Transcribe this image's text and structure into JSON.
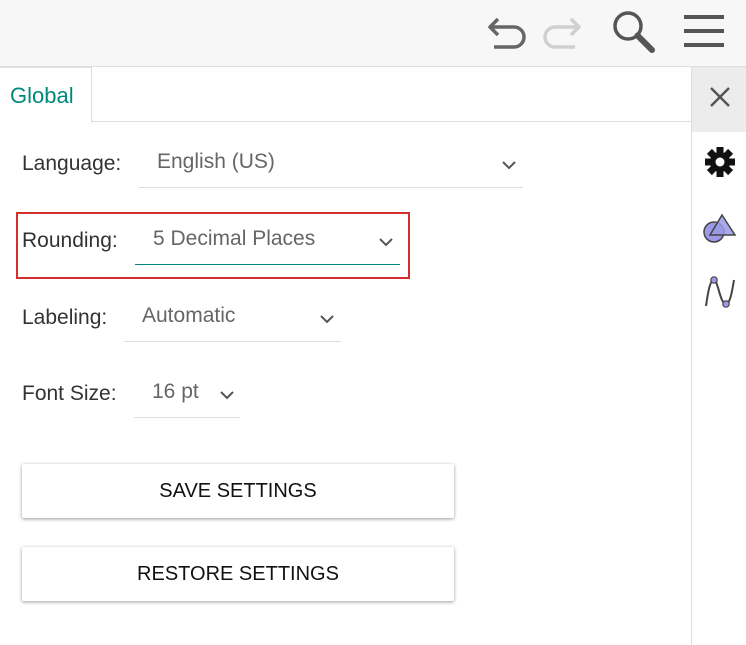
{
  "toolbar": {
    "undo_icon": "undo-icon",
    "redo_icon": "redo-icon",
    "search_icon": "search-icon",
    "menu_icon": "menu-icon"
  },
  "tabs": [
    {
      "label": "Global",
      "active": true
    }
  ],
  "settings": {
    "language": {
      "label": "Language:",
      "value": "English (US)"
    },
    "rounding": {
      "label": "Rounding:",
      "value": "5 Decimal Places"
    },
    "labeling": {
      "label": "Labeling:",
      "value": "Automatic"
    },
    "font_size": {
      "label": "Font Size:",
      "value": "16 pt"
    }
  },
  "buttons": {
    "save": "SAVE SETTINGS",
    "restore": "RESTORE SETTINGS"
  },
  "side_panel": {
    "items": [
      "close-icon",
      "gear-icon",
      "graphics-shapes-icon",
      "algebra-curve-icon"
    ]
  },
  "colors": {
    "accent": "#00897b",
    "highlight": "#d32f2f",
    "toolbar_bg": "#f7f7f7"
  }
}
